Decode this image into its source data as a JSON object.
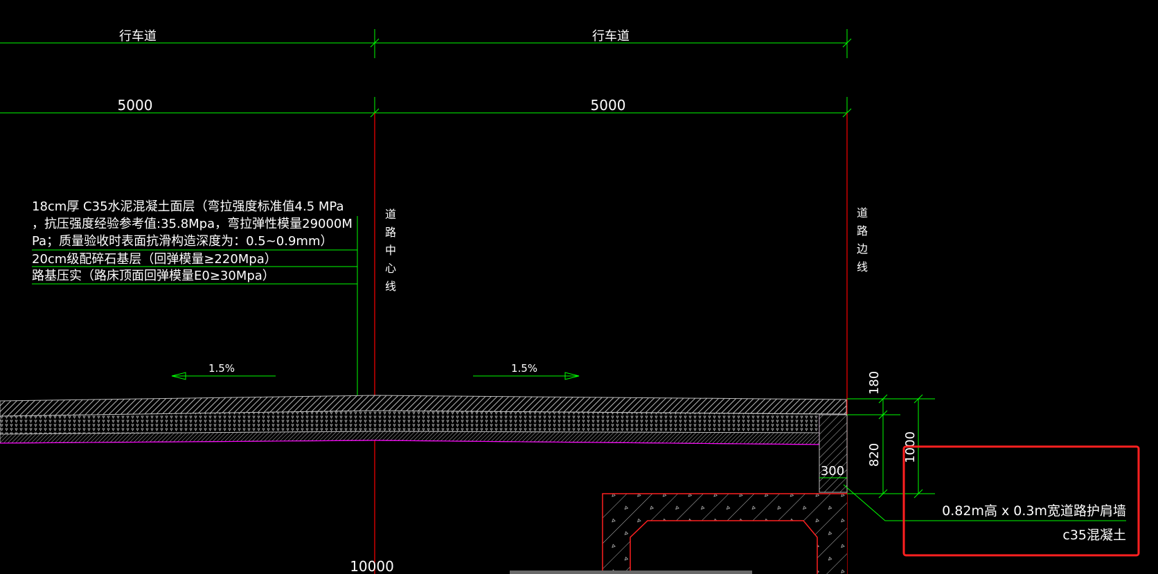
{
  "colors": {
    "background": "#000000",
    "dimension": "#00ff00",
    "centerline": "#ff0000",
    "pavement": "#c0c0c0",
    "subgrade": "#ff00ff",
    "highlight": "#ff2020",
    "text": "#ffffff"
  },
  "top_dims": {
    "lane_left": "行车道",
    "lane_right": "行车道",
    "width_left": "5000",
    "width_right": "5000",
    "bottom_total": "10000"
  },
  "axis_labels": {
    "centerline": [
      "道",
      "路",
      "中",
      "心",
      "线"
    ],
    "edge_line": [
      "道",
      "路",
      "边",
      "线"
    ]
  },
  "layers": {
    "line1": "18cm厚  C35水泥混凝土面层（弯拉强度标准值4.5  MPa",
    "line2": "，抗压强度经验参考值:35.8Mpa，弯拉弹性模量29000M",
    "line3": "Pa；质量验收时表面抗滑构造深度为：0.5~0.9mm）",
    "line4": "20cm级配碎石基层（回弹模量≥220Mpa）",
    "line5": "路基压实（路床顶面回弹模量E0≥30Mpa）"
  },
  "slopes": {
    "left": "1.5%",
    "right": "1.5%"
  },
  "side_dims": {
    "d180": "180",
    "d820": "820",
    "d1000": "1000",
    "d300": "300"
  },
  "annotation": {
    "wall": "0.82m高 x 0.3m宽道路护肩墙",
    "material": "c35混凝土"
  }
}
